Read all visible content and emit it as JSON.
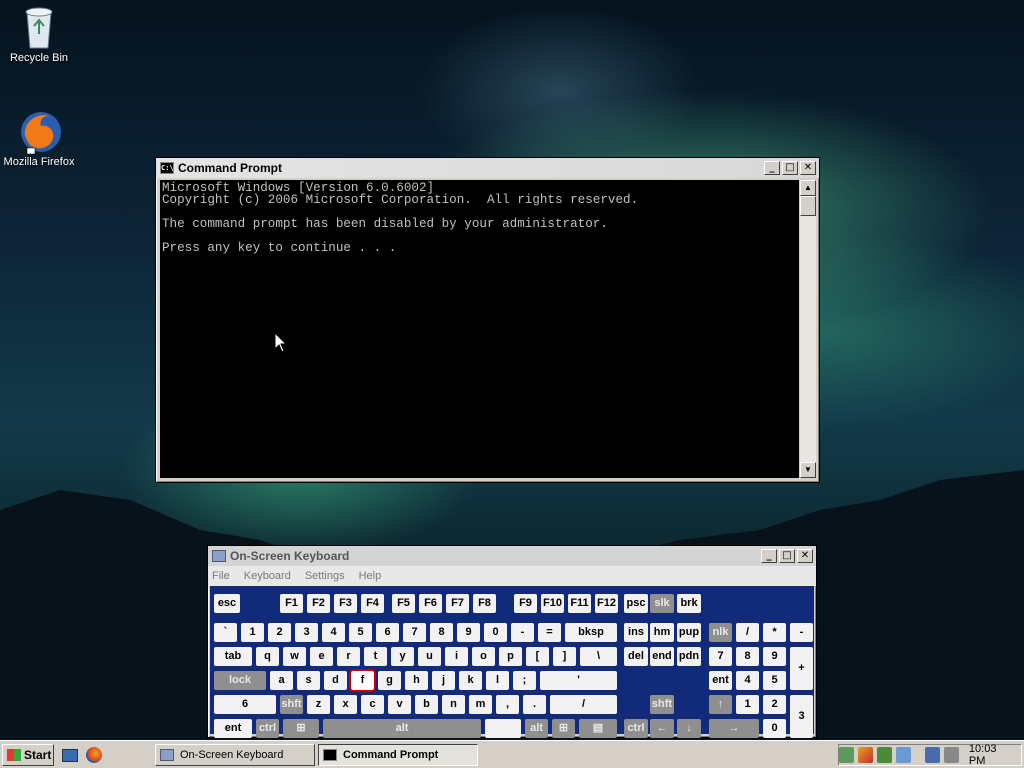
{
  "desktop": {
    "icons": [
      {
        "label": "Recycle Bin",
        "icon": "recycle-bin-icon"
      },
      {
        "label": "Mozilla Firefox",
        "icon": "firefox-icon"
      }
    ]
  },
  "cmd_window": {
    "title": "Command Prompt",
    "lines": [
      "Microsoft Windows [Version 6.0.6002]",
      "Copyright (c) 2006 Microsoft Corporation.  All rights reserved.",
      "",
      "The command prompt has been disabled by your administrator.",
      "",
      "Press any key to continue . . ."
    ]
  },
  "osk_window": {
    "title": "On-Screen Keyboard",
    "menu": [
      "File",
      "Keyboard",
      "Settings",
      "Help"
    ],
    "highlighted_key": "f",
    "keys": [
      "esc",
      "F1",
      "F2",
      "F3",
      "F4",
      "F5",
      "F6",
      "F7",
      "F8",
      "F9",
      "F10",
      "F11",
      "F12",
      "psc",
      "slk",
      "brk",
      "`",
      "1",
      "2",
      "3",
      "4",
      "5",
      "6",
      "7",
      "8",
      "9",
      "0",
      "-",
      "=",
      "bksp",
      "ins",
      "hm",
      "pup",
      "nlk",
      "/",
      "*",
      "-",
      "tab",
      "q",
      "w",
      "e",
      "r",
      "t",
      "y",
      "u",
      "i",
      "o",
      "p",
      "[",
      "]",
      "\\",
      "del",
      "end",
      "pdn",
      "7",
      "8",
      "9",
      "+",
      "lock",
      "a",
      "s",
      "d",
      "f",
      "g",
      "h",
      "j",
      "k",
      "l",
      ";",
      "'",
      "ent",
      "4",
      "5",
      "6",
      "shft",
      "z",
      "x",
      "c",
      "v",
      "b",
      "n",
      "m",
      ",",
      ".",
      "/",
      "shft",
      "↑",
      "1",
      "2",
      "3",
      "ent",
      "ctrl",
      "⊞",
      "alt",
      "",
      "alt",
      "⊞",
      "▤",
      "ctrl",
      "←",
      "↓",
      "→",
      "0",
      "."
    ]
  },
  "taskbar": {
    "start_label": "Start",
    "buttons": [
      "On-Screen Keyboard",
      "Command Prompt"
    ],
    "active_button": "Command Prompt",
    "clock": "10:03 PM"
  }
}
